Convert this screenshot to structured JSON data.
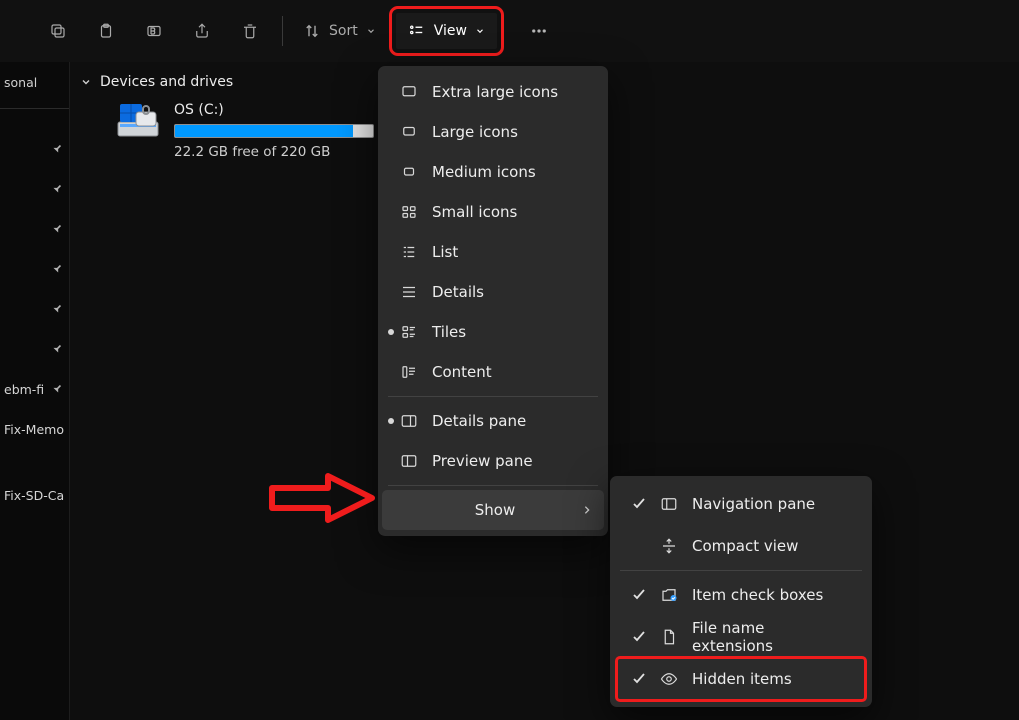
{
  "toolbar": {
    "sort_label": "Sort",
    "view_label": "View"
  },
  "sidebar": {
    "items": [
      {
        "label": "sonal"
      },
      {
        "label": ""
      },
      {
        "label": ""
      },
      {
        "label": ""
      },
      {
        "label": ""
      },
      {
        "label": ""
      },
      {
        "label": ""
      },
      {
        "label": "ebm-fi"
      },
      {
        "label": "Fix-Memo"
      },
      {
        "label": "Fix-SD-Ca"
      }
    ]
  },
  "section": {
    "header": "Devices and drives",
    "drive": {
      "name": "OS (C:)",
      "free_text": "22.2 GB free of 220 GB",
      "used_percent": 90
    }
  },
  "view_menu": {
    "items": [
      {
        "id": "extra-large",
        "label": "Extra large icons",
        "radio": false
      },
      {
        "id": "large",
        "label": "Large icons",
        "radio": false
      },
      {
        "id": "medium",
        "label": "Medium icons",
        "radio": false
      },
      {
        "id": "small",
        "label": "Small icons",
        "radio": false
      },
      {
        "id": "list",
        "label": "List",
        "radio": false
      },
      {
        "id": "details",
        "label": "Details",
        "radio": false
      },
      {
        "id": "tiles",
        "label": "Tiles",
        "radio": true
      },
      {
        "id": "content",
        "label": "Content",
        "radio": false
      }
    ],
    "details_pane": {
      "label": "Details pane",
      "radio": true
    },
    "preview_pane": {
      "label": "Preview pane",
      "radio": false
    },
    "show_label": "Show"
  },
  "show_submenu": {
    "items": [
      {
        "id": "navpane",
        "label": "Navigation pane",
        "checked": true
      },
      {
        "id": "compact",
        "label": "Compact view",
        "checked": false
      },
      {
        "id": "checkbx",
        "label": "Item check boxes",
        "checked": true
      },
      {
        "id": "ext",
        "label": "File name extensions",
        "checked": true
      },
      {
        "id": "hidden",
        "label": "Hidden items",
        "checked": true
      }
    ]
  }
}
